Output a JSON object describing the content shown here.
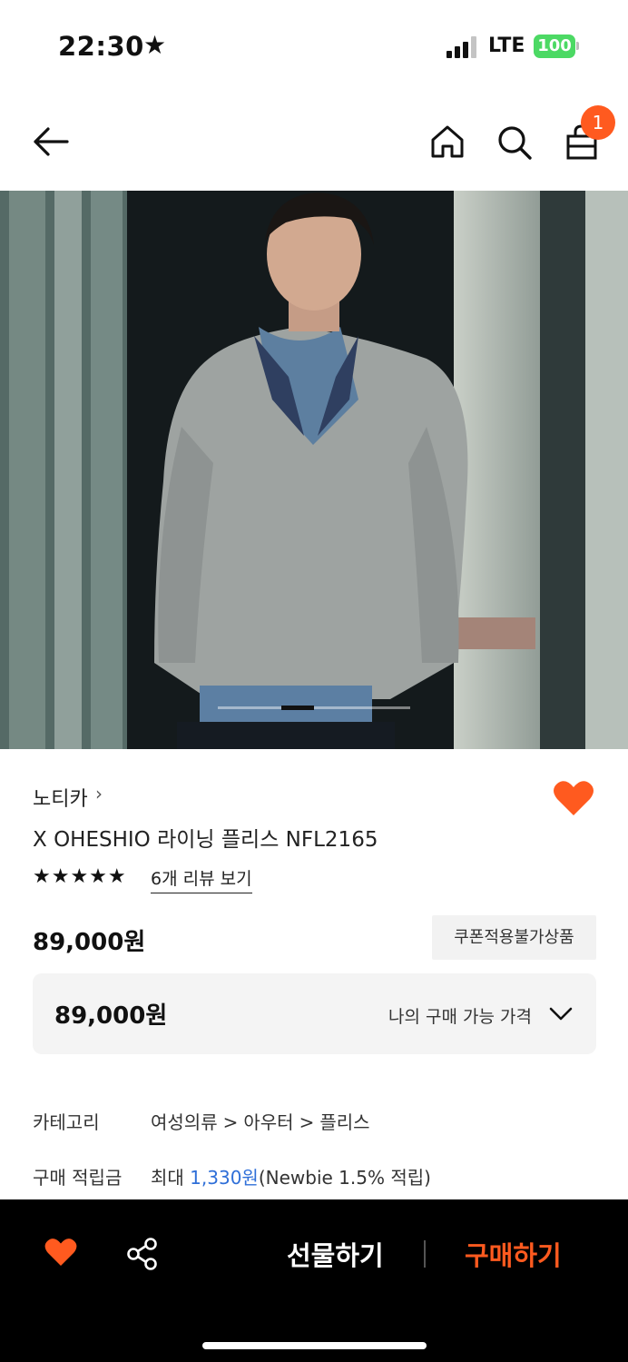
{
  "status": {
    "time": "22:30",
    "network": "LTE",
    "battery": "100"
  },
  "nav": {
    "back_icon": "arrow-left-icon",
    "home_icon": "home-icon",
    "search_icon": "search-icon",
    "cart_icon": "shopping-bag-icon",
    "cart_count": "1"
  },
  "gallery": {
    "image_alt_icon": "product-photo",
    "slide_progress": 0.33
  },
  "product": {
    "brand": "노티카",
    "name": "X OHESHIO 라이닝 플리스 NFL2165",
    "rating_stars": "★★★★★",
    "rating": 5,
    "review_link": "6개 리뷰 보기",
    "price": "89,000원",
    "coupon_notice": "쿠폰적용불가상품",
    "wishlisted": true
  },
  "my_price": {
    "value": "89,000원",
    "label": "나의 구매 가능 가격"
  },
  "details": {
    "category_label": "카테고리",
    "category_path": [
      "여성의류",
      "아우터",
      "플리스"
    ],
    "points_label": "구매 적립금",
    "points_prefix": "최대 ",
    "points_value": "1,330원",
    "points_suffix": "(Newbie 1.5% 적립)"
  },
  "bottom_bar": {
    "gift_label": "선물하기",
    "buy_label": "구매하기"
  },
  "colors": {
    "accent": "#ff5a1f",
    "link_blue": "#2f6fd8",
    "battery_green": "#4cd964"
  }
}
